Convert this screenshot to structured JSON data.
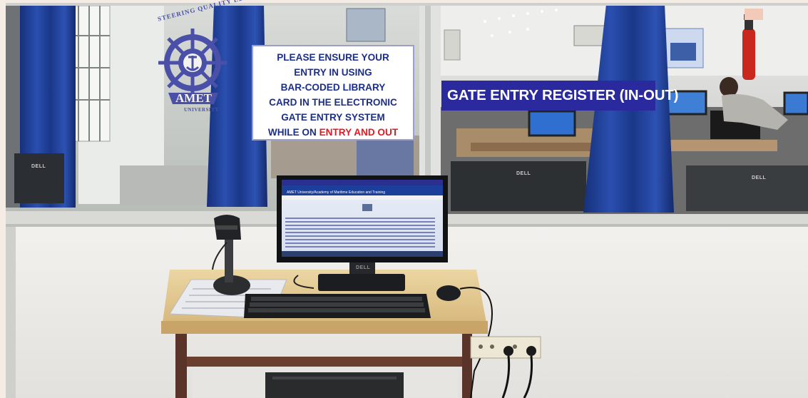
{
  "scene": {
    "notice_sign": {
      "lines": [
        "PLEASE ENSURE YOUR",
        "ENTRY IN USING",
        "BAR-CODED LIBRARY",
        "CARD IN THE ELECTRONIC",
        "GATE ENTRY SYSTEM"
      ],
      "last_line_prefix": "WHILE ON ",
      "last_line_highlight": "ENTRY AND OUT"
    },
    "banner_text": "GATE ENTRY REGISTER (IN-OUT)",
    "logo": {
      "arc_text": "STEERING QUALITY EDUCATION",
      "wordmark": "AMET",
      "subtext": "UNIVERSITY"
    },
    "monitor": {
      "brand": "DELL",
      "screen_title": "AMET University/Academy of Maritime Education and Training"
    },
    "background_monitor_brand": "DELL"
  },
  "colors": {
    "sign_text": "#1c2f8a",
    "sign_highlight": "#e01b22",
    "banner_bg": "#2a2a9e",
    "curtain": "#1f3a8f",
    "wall": "#f0eeea",
    "desk_top": "#e8cf9a"
  }
}
